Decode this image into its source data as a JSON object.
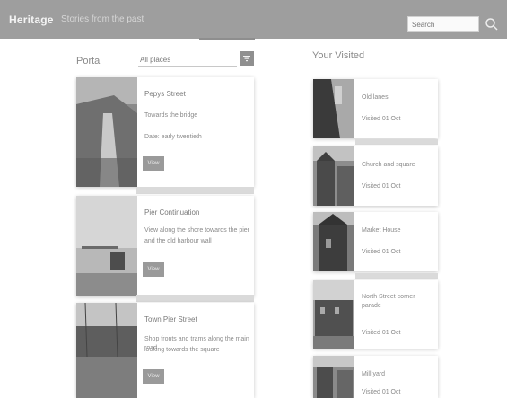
{
  "header": {
    "brand": "Heritage",
    "tagline": "Stories from the past",
    "search_placeholder": "Search"
  },
  "left_section": {
    "title": "Portal",
    "filter_value": "All places",
    "cards": [
      {
        "title": "Pepys Street",
        "line1": "Towards the bridge",
        "line2": "Date: early twentieth",
        "button": "View"
      },
      {
        "title": "Pier Continuation",
        "line1": "View along the shore towards the pier",
        "line2": "and the old harbour wall",
        "button": "View"
      },
      {
        "title": "Town Pier Street",
        "line1": "Shop fronts and trams along the main road",
        "line2": "looking towards the square",
        "button": "View"
      }
    ]
  },
  "right_section": {
    "title": "Your Visited",
    "cards": [
      {
        "title": "Old lanes",
        "meta": "Visited 01 Oct"
      },
      {
        "title": "Church and square",
        "meta": "Visited 01 Oct"
      },
      {
        "title": "Market House",
        "meta": "Visited 01 Oct"
      },
      {
        "title": "North Street corner parade",
        "meta": "Visited 01 Oct"
      },
      {
        "title": "Mill yard",
        "meta": "Visited 01 Oct"
      }
    ]
  },
  "colors": {
    "header_bg": "#9e9e9e",
    "card_shadow": "#cfcfcf",
    "button_bg": "#9a9a9a"
  },
  "icons": {
    "search": "search-icon",
    "filter": "filter-icon"
  }
}
